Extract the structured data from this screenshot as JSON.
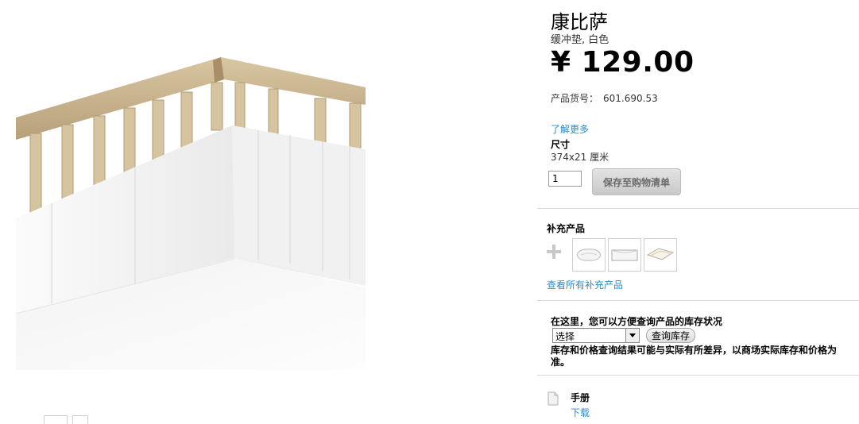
{
  "product": {
    "name": "康比萨",
    "description": "缓冲垫, 白色",
    "price": "¥ 129.00",
    "article_label": "产品货号：",
    "article_number": "601.690.53",
    "learn_more": "了解更多",
    "size_label": "尺寸",
    "size_value": "374x21 厘米"
  },
  "purchase": {
    "quantity": "1",
    "save_label": "保存至购物清单"
  },
  "complementary": {
    "title": "补充产品",
    "view_all": "查看所有补充产品",
    "thumbnails": [
      "pillow-thumbnail",
      "pillow-case-thumbnail",
      "pillowcase-folded-thumbnail"
    ]
  },
  "stock": {
    "title": "在这里，您可以方便查询产品的库存状况",
    "select_value": "选择",
    "check_label": "查询库存",
    "note": "库存和价格查询结果可能与实际有所差异，以商场实际库存和价格为准。"
  },
  "manual": {
    "label": "手册",
    "download": "下载"
  },
  "colors": {
    "link": "#2a8bc7",
    "crib_wood": "#c9b48e",
    "bumper": "#f4f4f4"
  }
}
